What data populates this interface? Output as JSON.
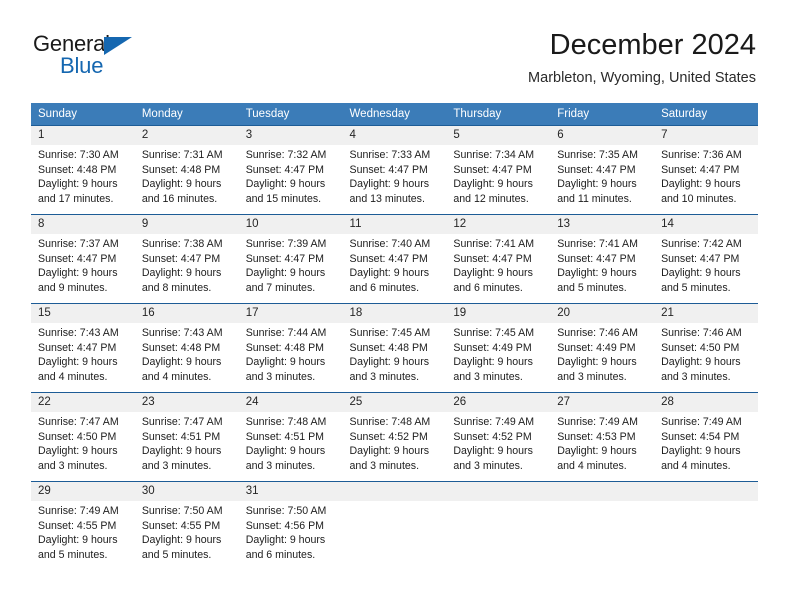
{
  "brand": {
    "name_part1": "General",
    "name_part2": "Blue",
    "logo_icon": "triangle-flag-icon"
  },
  "header": {
    "title": "December 2024",
    "location": "Marbleton, Wyoming, United States"
  },
  "calendar": {
    "accent_header_color": "#3b7cb8",
    "accent_border_color": "#1d5c96",
    "daynum_band_color": "#f0f0f0",
    "weekday_headers": [
      "Sunday",
      "Monday",
      "Tuesday",
      "Wednesday",
      "Thursday",
      "Friday",
      "Saturday"
    ],
    "weeks": [
      [
        {
          "day": "1",
          "sunrise": "Sunrise: 7:30 AM",
          "sunset": "Sunset: 4:48 PM",
          "daylight_line1": "Daylight: 9 hours",
          "daylight_line2": "and 17 minutes."
        },
        {
          "day": "2",
          "sunrise": "Sunrise: 7:31 AM",
          "sunset": "Sunset: 4:48 PM",
          "daylight_line1": "Daylight: 9 hours",
          "daylight_line2": "and 16 minutes."
        },
        {
          "day": "3",
          "sunrise": "Sunrise: 7:32 AM",
          "sunset": "Sunset: 4:47 PM",
          "daylight_line1": "Daylight: 9 hours",
          "daylight_line2": "and 15 minutes."
        },
        {
          "day": "4",
          "sunrise": "Sunrise: 7:33 AM",
          "sunset": "Sunset: 4:47 PM",
          "daylight_line1": "Daylight: 9 hours",
          "daylight_line2": "and 13 minutes."
        },
        {
          "day": "5",
          "sunrise": "Sunrise: 7:34 AM",
          "sunset": "Sunset: 4:47 PM",
          "daylight_line1": "Daylight: 9 hours",
          "daylight_line2": "and 12 minutes."
        },
        {
          "day": "6",
          "sunrise": "Sunrise: 7:35 AM",
          "sunset": "Sunset: 4:47 PM",
          "daylight_line1": "Daylight: 9 hours",
          "daylight_line2": "and 11 minutes."
        },
        {
          "day": "7",
          "sunrise": "Sunrise: 7:36 AM",
          "sunset": "Sunset: 4:47 PM",
          "daylight_line1": "Daylight: 9 hours",
          "daylight_line2": "and 10 minutes."
        }
      ],
      [
        {
          "day": "8",
          "sunrise": "Sunrise: 7:37 AM",
          "sunset": "Sunset: 4:47 PM",
          "daylight_line1": "Daylight: 9 hours",
          "daylight_line2": "and 9 minutes."
        },
        {
          "day": "9",
          "sunrise": "Sunrise: 7:38 AM",
          "sunset": "Sunset: 4:47 PM",
          "daylight_line1": "Daylight: 9 hours",
          "daylight_line2": "and 8 minutes."
        },
        {
          "day": "10",
          "sunrise": "Sunrise: 7:39 AM",
          "sunset": "Sunset: 4:47 PM",
          "daylight_line1": "Daylight: 9 hours",
          "daylight_line2": "and 7 minutes."
        },
        {
          "day": "11",
          "sunrise": "Sunrise: 7:40 AM",
          "sunset": "Sunset: 4:47 PM",
          "daylight_line1": "Daylight: 9 hours",
          "daylight_line2": "and 6 minutes."
        },
        {
          "day": "12",
          "sunrise": "Sunrise: 7:41 AM",
          "sunset": "Sunset: 4:47 PM",
          "daylight_line1": "Daylight: 9 hours",
          "daylight_line2": "and 6 minutes."
        },
        {
          "day": "13",
          "sunrise": "Sunrise: 7:41 AM",
          "sunset": "Sunset: 4:47 PM",
          "daylight_line1": "Daylight: 9 hours",
          "daylight_line2": "and 5 minutes."
        },
        {
          "day": "14",
          "sunrise": "Sunrise: 7:42 AM",
          "sunset": "Sunset: 4:47 PM",
          "daylight_line1": "Daylight: 9 hours",
          "daylight_line2": "and 5 minutes."
        }
      ],
      [
        {
          "day": "15",
          "sunrise": "Sunrise: 7:43 AM",
          "sunset": "Sunset: 4:47 PM",
          "daylight_line1": "Daylight: 9 hours",
          "daylight_line2": "and 4 minutes."
        },
        {
          "day": "16",
          "sunrise": "Sunrise: 7:43 AM",
          "sunset": "Sunset: 4:48 PM",
          "daylight_line1": "Daylight: 9 hours",
          "daylight_line2": "and 4 minutes."
        },
        {
          "day": "17",
          "sunrise": "Sunrise: 7:44 AM",
          "sunset": "Sunset: 4:48 PM",
          "daylight_line1": "Daylight: 9 hours",
          "daylight_line2": "and 3 minutes."
        },
        {
          "day": "18",
          "sunrise": "Sunrise: 7:45 AM",
          "sunset": "Sunset: 4:48 PM",
          "daylight_line1": "Daylight: 9 hours",
          "daylight_line2": "and 3 minutes."
        },
        {
          "day": "19",
          "sunrise": "Sunrise: 7:45 AM",
          "sunset": "Sunset: 4:49 PM",
          "daylight_line1": "Daylight: 9 hours",
          "daylight_line2": "and 3 minutes."
        },
        {
          "day": "20",
          "sunrise": "Sunrise: 7:46 AM",
          "sunset": "Sunset: 4:49 PM",
          "daylight_line1": "Daylight: 9 hours",
          "daylight_line2": "and 3 minutes."
        },
        {
          "day": "21",
          "sunrise": "Sunrise: 7:46 AM",
          "sunset": "Sunset: 4:50 PM",
          "daylight_line1": "Daylight: 9 hours",
          "daylight_line2": "and 3 minutes."
        }
      ],
      [
        {
          "day": "22",
          "sunrise": "Sunrise: 7:47 AM",
          "sunset": "Sunset: 4:50 PM",
          "daylight_line1": "Daylight: 9 hours",
          "daylight_line2": "and 3 minutes."
        },
        {
          "day": "23",
          "sunrise": "Sunrise: 7:47 AM",
          "sunset": "Sunset: 4:51 PM",
          "daylight_line1": "Daylight: 9 hours",
          "daylight_line2": "and 3 minutes."
        },
        {
          "day": "24",
          "sunrise": "Sunrise: 7:48 AM",
          "sunset": "Sunset: 4:51 PM",
          "daylight_line1": "Daylight: 9 hours",
          "daylight_line2": "and 3 minutes."
        },
        {
          "day": "25",
          "sunrise": "Sunrise: 7:48 AM",
          "sunset": "Sunset: 4:52 PM",
          "daylight_line1": "Daylight: 9 hours",
          "daylight_line2": "and 3 minutes."
        },
        {
          "day": "26",
          "sunrise": "Sunrise: 7:49 AM",
          "sunset": "Sunset: 4:52 PM",
          "daylight_line1": "Daylight: 9 hours",
          "daylight_line2": "and 3 minutes."
        },
        {
          "day": "27",
          "sunrise": "Sunrise: 7:49 AM",
          "sunset": "Sunset: 4:53 PM",
          "daylight_line1": "Daylight: 9 hours",
          "daylight_line2": "and 4 minutes."
        },
        {
          "day": "28",
          "sunrise": "Sunrise: 7:49 AM",
          "sunset": "Sunset: 4:54 PM",
          "daylight_line1": "Daylight: 9 hours",
          "daylight_line2": "and 4 minutes."
        }
      ],
      [
        {
          "day": "29",
          "sunrise": "Sunrise: 7:49 AM",
          "sunset": "Sunset: 4:55 PM",
          "daylight_line1": "Daylight: 9 hours",
          "daylight_line2": "and 5 minutes."
        },
        {
          "day": "30",
          "sunrise": "Sunrise: 7:50 AM",
          "sunset": "Sunset: 4:55 PM",
          "daylight_line1": "Daylight: 9 hours",
          "daylight_line2": "and 5 minutes."
        },
        {
          "day": "31",
          "sunrise": "Sunrise: 7:50 AM",
          "sunset": "Sunset: 4:56 PM",
          "daylight_line1": "Daylight: 9 hours",
          "daylight_line2": "and 6 minutes."
        },
        {
          "day": "",
          "sunrise": "",
          "sunset": "",
          "daylight_line1": "",
          "daylight_line2": ""
        },
        {
          "day": "",
          "sunrise": "",
          "sunset": "",
          "daylight_line1": "",
          "daylight_line2": ""
        },
        {
          "day": "",
          "sunrise": "",
          "sunset": "",
          "daylight_line1": "",
          "daylight_line2": ""
        },
        {
          "day": "",
          "sunrise": "",
          "sunset": "",
          "daylight_line1": "",
          "daylight_line2": ""
        }
      ]
    ]
  }
}
